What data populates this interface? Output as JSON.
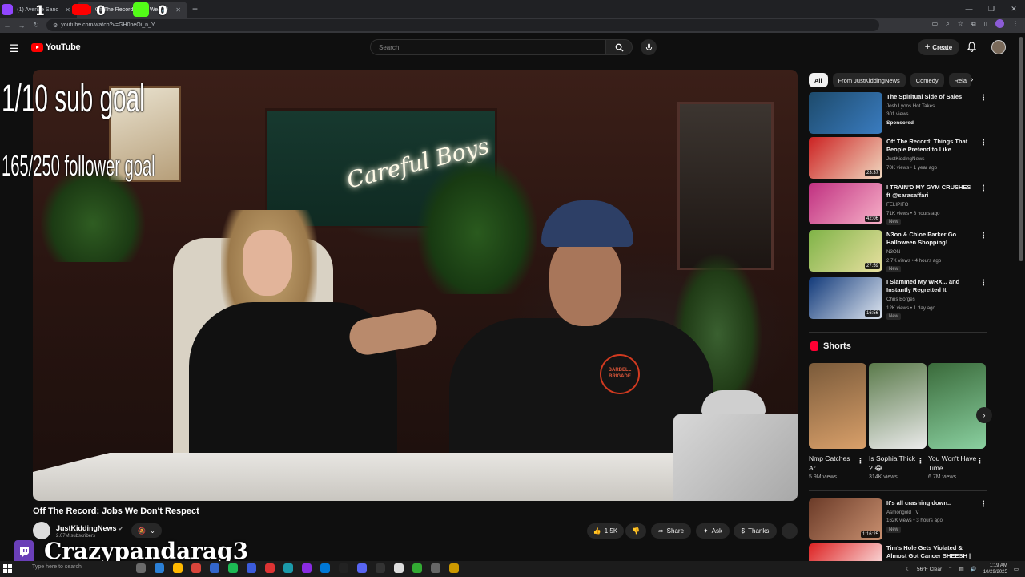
{
  "browser": {
    "tabs": [
      {
        "label": "(1) Avenue Sanctuary - Twitch",
        "favicon_color": "#9146ff",
        "active": false
      },
      {
        "label": "Off The Record: Jobs We Don't Respect",
        "favicon_color": "#ff0000",
        "active": true
      }
    ],
    "overlay_counters": [
      "1",
      "0",
      "0"
    ],
    "url": "youtube.com/watch?v=GH0beOi_n_Y",
    "window_controls": [
      "—",
      "❐",
      "✕"
    ]
  },
  "youtube": {
    "logo_text": "YouTube",
    "search_placeholder": "Search",
    "create_label": "Create"
  },
  "overlay": {
    "goal_sub": "1/10 sub goal",
    "goal_follower": "165/250 follower goal",
    "streamer_name": "Crazypandarag3"
  },
  "video": {
    "neon_sign": "Careful Boys",
    "title": "Off The Record: Jobs We Don't Respect",
    "channel_name": "JustKiddingNews",
    "subscribers": "2.07M subscribers",
    "likes": "1.5K",
    "share_label": "Share",
    "ask_label": "Ask",
    "thanks_label": "Thanks",
    "shirt_logo": "BARBELL BRIGADE"
  },
  "chips": [
    "All",
    "From JustKiddingNews",
    "Comedy",
    "Rela"
  ],
  "recommendations": [
    {
      "title": "The Spiritual Side of Sales",
      "channel": "Josh Lyons Hot Takes",
      "meta": "301 views",
      "extra": "Sponsored",
      "duration": "",
      "thumb_colors": [
        "#1d4a6b",
        "#3a7cc0"
      ]
    },
    {
      "title": "Off The Record: Things That People Pretend to Like",
      "channel": "JustKiddingNews",
      "meta": "70K views • 1 year ago",
      "extra": "",
      "duration": "23:37",
      "thumb_colors": [
        "#c22",
        "#f0d8c0"
      ]
    },
    {
      "title": "I TRAIN'D MY GYM CRUSHES ft @sarasaffari",
      "channel": "FELIPITO",
      "meta": "71K views • 8 hours ago",
      "extra": "New",
      "duration": "42:06",
      "thumb_colors": [
        "#c03080",
        "#f7b1c8"
      ]
    },
    {
      "title": "N3on & Chloe Parker Go Halloween Shopping!",
      "channel": "N3ON",
      "meta": "2.7K views • 4 hours ago",
      "extra": "New",
      "duration": "27:59",
      "thumb_colors": [
        "#7fb347",
        "#e8e0a0"
      ]
    },
    {
      "title": "I Slammed My WRX... and Instantly Regretted It",
      "channel": "Chris Borges",
      "meta": "12K views • 1 day ago",
      "extra": "New",
      "duration": "16:56",
      "thumb_colors": [
        "#123a7a",
        "#dfe6f0"
      ]
    },
    {
      "title": "It's all crashing down..",
      "channel": "Asmongold TV",
      "meta": "162K views • 3 hours ago",
      "extra": "New",
      "duration": "1:16:25",
      "thumb_colors": [
        "#6b3b28",
        "#c99070"
      ]
    },
    {
      "title": "Tim's Hole Gets Violated & Almost Got Cancer SHEESH | ...",
      "channel": "",
      "meta": "",
      "extra": "",
      "duration": "",
      "thumb_colors": [
        "#d22",
        "#fff"
      ]
    }
  ],
  "shorts": {
    "heading": "Shorts",
    "items": [
      {
        "title": "Nmp Catches Ar...",
        "views": "5.9M views",
        "thumb_colors": [
          "#7a5a3a",
          "#d9a06a"
        ]
      },
      {
        "title": "Is Sophia Thick ? 😂 ...",
        "views": "314K views",
        "thumb_colors": [
          "#5a7a4a",
          "#eaeaea"
        ]
      },
      {
        "title": "You Won't Have Time ...",
        "views": "6.7M views",
        "thumb_colors": [
          "#3a6a3a",
          "#8ad0a0"
        ]
      }
    ]
  },
  "taskbar": {
    "search_placeholder": "Type here to search",
    "weather": "56°F  Clear",
    "time": "1:19 AM",
    "date": "10/29/2025",
    "app_colors": [
      "#6b6b6b",
      "#2b80d6",
      "#ffb900",
      "#d9453b",
      "#36c",
      "#1db954",
      "#3b5bdb",
      "#d33",
      "#1b9aaa",
      "#8a2be2",
      "#0078d7",
      "#222",
      "#5865f2",
      "#333",
      "#ddd",
      "#3a3",
      "#666",
      "#c90"
    ]
  }
}
